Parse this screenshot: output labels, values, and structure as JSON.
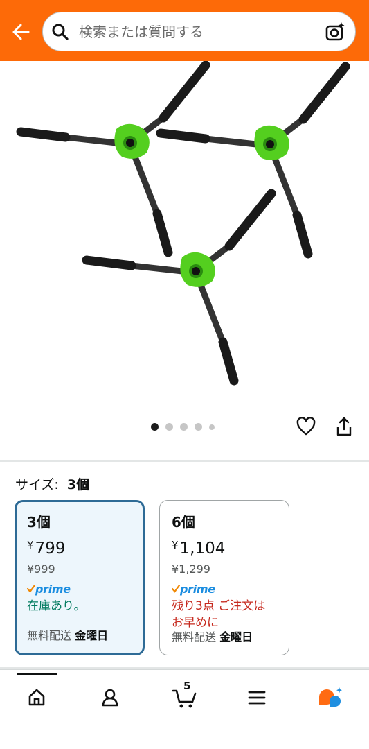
{
  "header": {
    "search_placeholder": "検索または質問する",
    "accent_color": "#fd6a08"
  },
  "icons": {
    "back": "back-arrow-icon",
    "search": "search-icon",
    "camera": "camera-sparkle-icon",
    "heart": "heart-icon",
    "share": "share-icon",
    "home": "home-icon",
    "account": "account-icon",
    "cart": "cart-icon",
    "menu": "menu-icon",
    "rufus": "rufus-assistant-icon"
  },
  "gallery": {
    "image_count": 5,
    "active_index": 0
  },
  "size": {
    "label": "サイズ:",
    "value": "3個"
  },
  "options": [
    {
      "qty": "3個",
      "currency": "¥",
      "price": "799",
      "old_price": "¥999",
      "prime": "prime",
      "stock": "在庫あり。",
      "shipping_label": "無料配送",
      "shipping_day": "金曜日",
      "selected": true
    },
    {
      "qty": "6個",
      "currency": "¥",
      "price": "1,104",
      "old_price": "¥1,299",
      "prime": "prime",
      "stock_line1": "残り3点 ご注文は",
      "stock_line2": "お早めに",
      "shipping_label": "無料配送",
      "shipping_day": "金曜日",
      "selected": false
    }
  ],
  "nav": {
    "cart_count": "5"
  }
}
